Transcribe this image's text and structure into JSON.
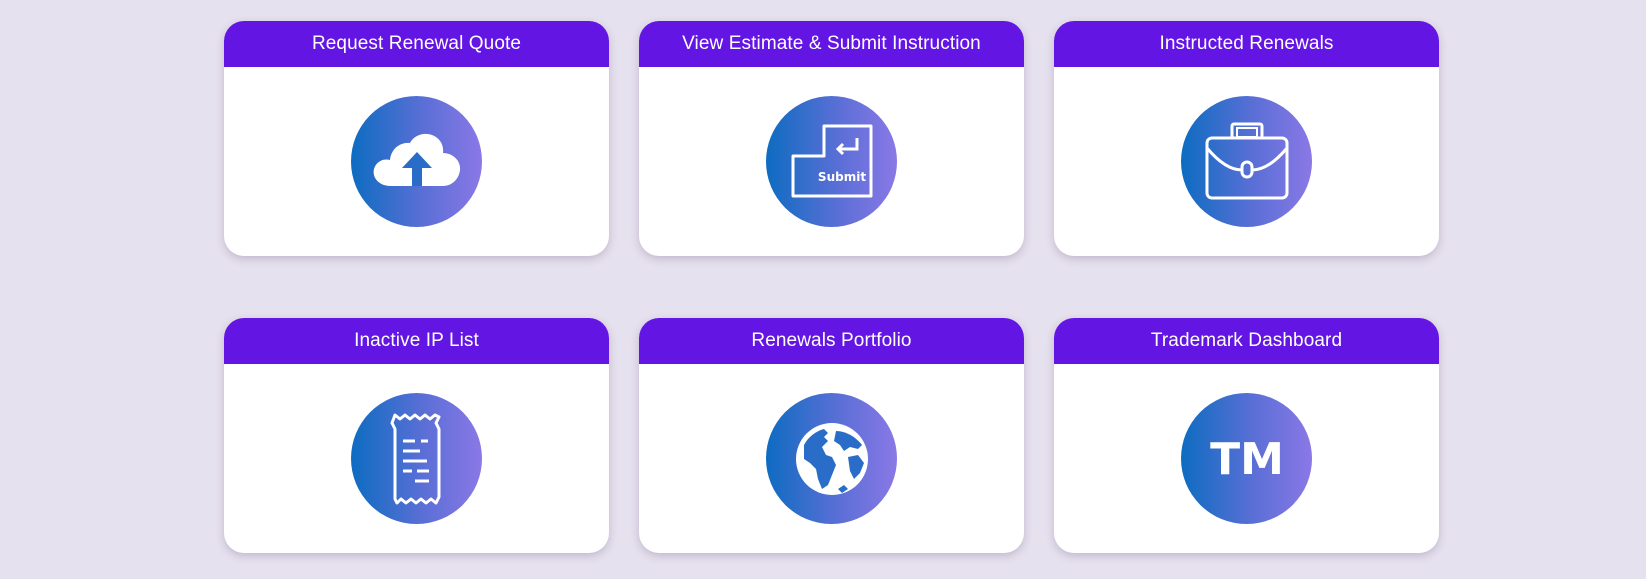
{
  "cards": [
    {
      "title": "Request Renewal Quote",
      "icon": "cloud-upload-icon"
    },
    {
      "title": "View Estimate & Submit Instruction",
      "icon": "submit-key-icon",
      "icon_text": "Submit"
    },
    {
      "title": "Instructed Renewals",
      "icon": "briefcase-icon"
    },
    {
      "title": "Inactive IP List",
      "icon": "receipt-list-icon"
    },
    {
      "title": "Renewals Portfolio",
      "icon": "globe-icon"
    },
    {
      "title": "Trademark Dashboard",
      "icon": "trademark-icon",
      "icon_text": "TM"
    }
  ],
  "colors": {
    "background": "#e6e1ee",
    "header": "#6315e3",
    "icon_gradient_start": "#0d6cc1",
    "icon_gradient_end": "#8a78e6"
  }
}
